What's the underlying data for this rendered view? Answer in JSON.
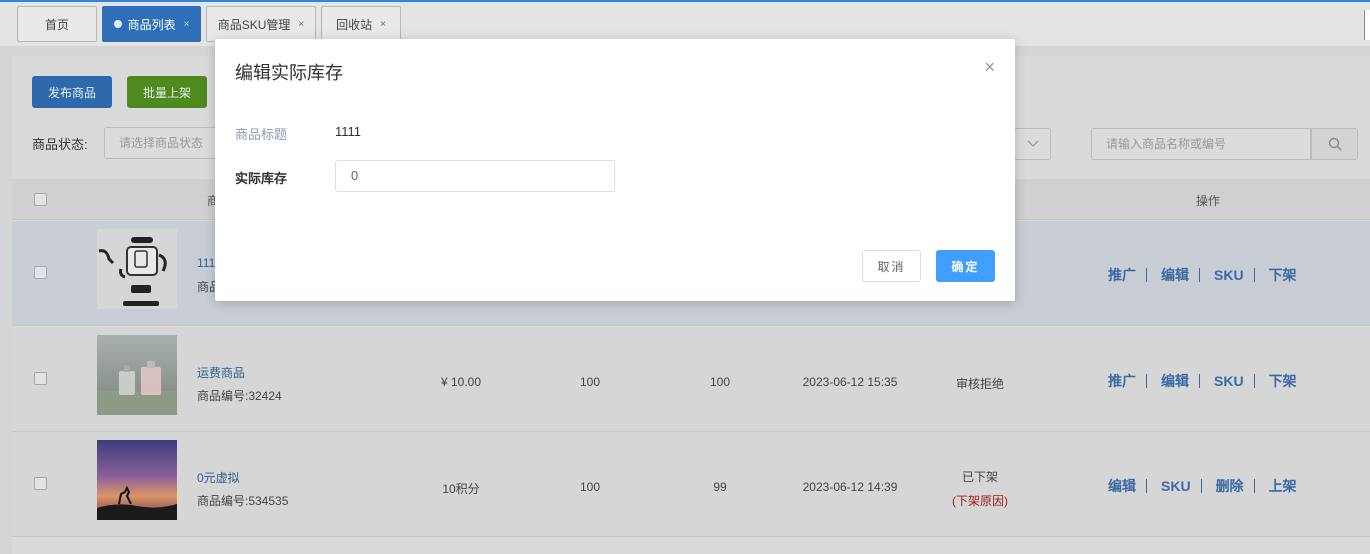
{
  "tabs": [
    {
      "label": "首页",
      "active": false,
      "closable": false
    },
    {
      "label": "商品列表",
      "active": true,
      "closable": true
    },
    {
      "label": "商品SKU管理",
      "active": false,
      "closable": true
    },
    {
      "label": "回收站",
      "active": false,
      "closable": true
    }
  ],
  "toolbar": {
    "publish_label": "发布商品",
    "batch_label": "批量上架"
  },
  "filter": {
    "status_label": "商品状态:",
    "status_placeholder": "请选择商品状态",
    "search_placeholder": "请输入商品名称或编号"
  },
  "table": {
    "headers": {
      "product": "商",
      "actions": "操作"
    },
    "rows": [
      {
        "name": "111",
        "code": "商品",
        "price": "",
        "col3": "",
        "col4": "",
        "time": "",
        "status": "",
        "reason": "",
        "ops": [
          "推广",
          "编辑",
          "SKU",
          "下架"
        ]
      },
      {
        "name": "运费商品",
        "code": "商品编号:32424",
        "price": "¥ 10.00",
        "col3": "100",
        "col4": "100",
        "time": "2023-06-12 15:35",
        "status": "审核拒绝",
        "reason": "",
        "ops": [
          "推广",
          "编辑",
          "SKU",
          "下架"
        ]
      },
      {
        "name": "0元虚拟",
        "code": "商品编号:534535",
        "price": "10积分",
        "col3": "100",
        "col4": "99",
        "time": "2023-06-12 14:39",
        "status": "已下架",
        "reason": "(下架原因)",
        "ops": [
          "编辑",
          "SKU",
          "删除",
          "上架"
        ]
      }
    ]
  },
  "modal": {
    "title": "编辑实际库存",
    "close_glyph": "×",
    "title_field_label": "商品标题",
    "title_field_value": "1111",
    "stock_label": "实际库存",
    "stock_value": "0",
    "cancel_label": "取消",
    "ok_label": "确定"
  },
  "colors": {
    "accent": "#409eff",
    "primary_dim": "#2f6eb8",
    "success_dim": "#4f8a1e",
    "danger": "#9b1d1d"
  }
}
